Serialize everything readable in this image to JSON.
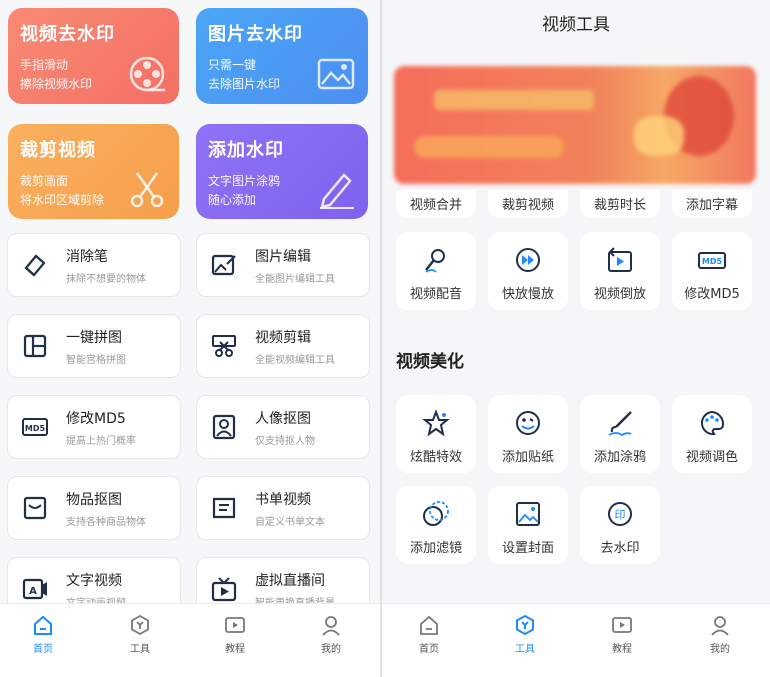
{
  "left": {
    "big_cards": [
      {
        "title": "视频去水印",
        "line1": "手指滑动",
        "line2": "擦除视频水印",
        "color": "#f77b6b",
        "icon": "film-reel-icon"
      },
      {
        "title": "图片去水印",
        "line1": "只需一键",
        "line2": "去除图片水印",
        "color": "#4d9bf3",
        "icon": "image-icon"
      },
      {
        "title": "裁剪视频",
        "line1": "裁剪画面",
        "line2": "将水印区域剪除",
        "color": "#f7a955",
        "icon": "scissors-icon"
      },
      {
        "title": "添加水印",
        "line1": "文字图片涂鸦",
        "line2": "随心添加",
        "color": "#8a6cf2",
        "icon": "pen-icon"
      }
    ],
    "cards": [
      {
        "title": "消除笔",
        "sub": "抹除不想要的物体",
        "icon": "eraser-icon"
      },
      {
        "title": "图片编辑",
        "sub": "全能图片编辑工具",
        "icon": "image-edit-icon"
      },
      {
        "title": "一键拼图",
        "sub": "智能宫格拼图",
        "icon": "collage-icon"
      },
      {
        "title": "视频剪辑",
        "sub": "全能视频编辑工具",
        "icon": "video-cut-icon"
      },
      {
        "title": "修改MD5",
        "sub": "提高上热门概率",
        "icon": "md5-icon"
      },
      {
        "title": "人像抠图",
        "sub": "仅支持抠人物",
        "icon": "portrait-icon"
      },
      {
        "title": "物品抠图",
        "sub": "支持各种商品物体",
        "icon": "object-cutout-icon"
      },
      {
        "title": "书单视频",
        "sub": "自定义书单文本",
        "icon": "book-icon"
      },
      {
        "title": "文字视频",
        "sub": "文字动画视频",
        "icon": "text-video-icon"
      },
      {
        "title": "虚拟直播间",
        "sub": "智能更换直播背景",
        "icon": "tv-icon"
      }
    ],
    "tabs": [
      {
        "label": "首页",
        "icon": "home-icon",
        "active": true
      },
      {
        "label": "工具",
        "icon": "tools-icon",
        "active": false
      },
      {
        "label": "教程",
        "icon": "tutorial-icon",
        "active": false
      },
      {
        "label": "我的",
        "icon": "user-icon",
        "active": false
      }
    ]
  },
  "right": {
    "title": "视频工具",
    "top_row": [
      "视频合并",
      "裁剪视频",
      "裁剪时长",
      "添加字幕"
    ],
    "row2": [
      {
        "label": "视频配音",
        "icon": "dubbing-icon"
      },
      {
        "label": "快放慢放",
        "icon": "speed-icon"
      },
      {
        "label": "视频倒放",
        "icon": "reverse-icon"
      },
      {
        "label": "修改MD5",
        "icon": "md5-icon"
      }
    ],
    "section": "视频美化",
    "beauty": [
      {
        "label": "炫酷特效",
        "icon": "effects-star-icon"
      },
      {
        "label": "添加贴纸",
        "icon": "sticker-icon"
      },
      {
        "label": "添加涂鸦",
        "icon": "brush-icon"
      },
      {
        "label": "视频调色",
        "icon": "palette-icon"
      },
      {
        "label": "添加滤镜",
        "icon": "filter-icon"
      },
      {
        "label": "设置封面",
        "icon": "cover-icon"
      },
      {
        "label": "去水印",
        "icon": "watermark-remove-icon"
      }
    ],
    "tabs": [
      {
        "label": "首页",
        "icon": "home-icon",
        "active": false
      },
      {
        "label": "工具",
        "icon": "tools-icon",
        "active": true
      },
      {
        "label": "教程",
        "icon": "tutorial-icon",
        "active": false
      },
      {
        "label": "我的",
        "icon": "user-icon",
        "active": false
      }
    ]
  },
  "colors": {
    "accent": "#1a8cff",
    "icon_dark": "#1f2f4a"
  }
}
